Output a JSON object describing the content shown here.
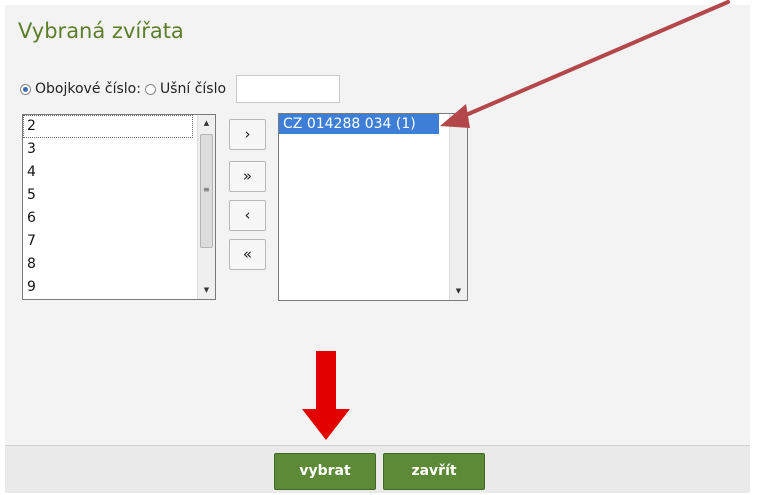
{
  "dialog": {
    "title": "Vybraná zvířata"
  },
  "filter": {
    "option_collar": "Obojkové číslo:",
    "option_ear": "Ušní číslo",
    "selected_option": "Obojkové číslo:",
    "input_value": ""
  },
  "available_list": {
    "items": [
      "2",
      "3",
      "4",
      "5",
      "6",
      "7",
      "8",
      "9"
    ],
    "focused_item": "2"
  },
  "selected_list": {
    "items": [
      "CZ 014288 034 (1)"
    ],
    "highlighted_item": "CZ 014288 034 (1)"
  },
  "move_buttons": {
    "add_one": "›",
    "add_all": "»",
    "remove_one": "‹",
    "remove_all": "«"
  },
  "footer": {
    "select_label": "vybrat",
    "close_label": "zavřít"
  },
  "colors": {
    "title_green": "#5e7d2a",
    "button_green": "#5c8a37",
    "selection_blue": "#3d7fd6",
    "annotation_red": "#e20000",
    "annotation_arrow": "#b3474a"
  }
}
